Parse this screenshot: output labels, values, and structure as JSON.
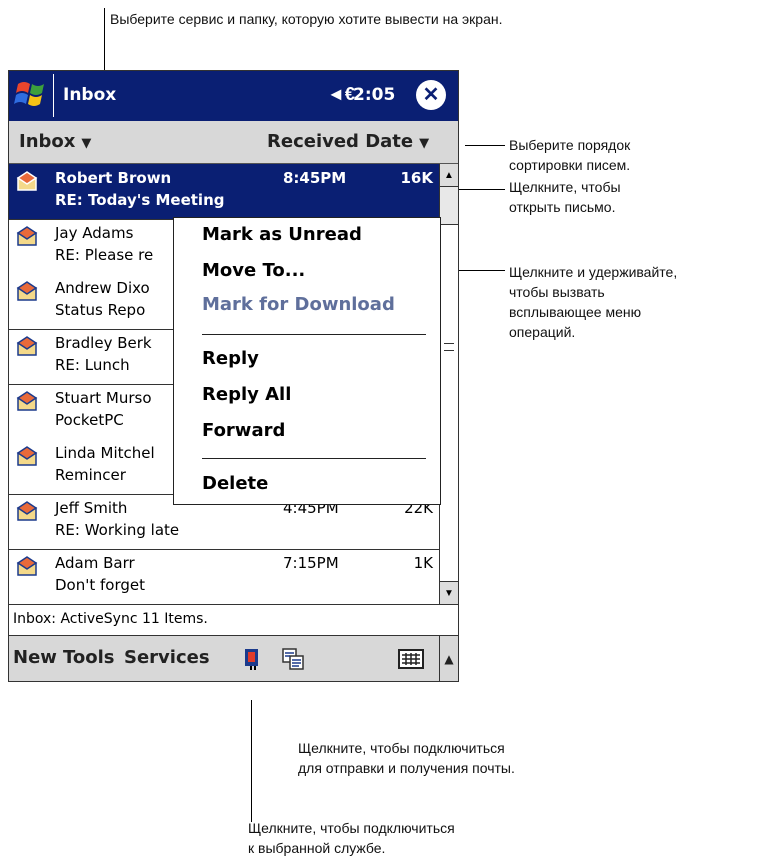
{
  "callouts": {
    "top": "Выберите сервис и папку, которую хотите вывести на экран.",
    "sort": "Выберите порядок\nсортировки писем.",
    "open": "Щелкните, чтобы\nоткрыть письмо.",
    "hold": "Щелкните и удерживайте,\nчтобы вызвать\nвсплывающее меню\nопераций.",
    "send_receive": "Щелкните, чтобы подключиться\nдля отправки и получения почты.",
    "connect_service": "Щелкните, чтобы подключиться\nк выбранной службе."
  },
  "titlebar": {
    "title": "Inbox",
    "volume_icon": "speaker-icon",
    "volume_glyph": "◄€",
    "time": "2:05",
    "close_glyph": "✕"
  },
  "sortbar": {
    "folder": "Inbox",
    "order": "Received Date",
    "arrow": "▼"
  },
  "messages": [
    {
      "sender": "Robert Brown",
      "subject": "RE: Today's Meeting",
      "time": "8:45PM",
      "size": "16K",
      "selected": true
    },
    {
      "sender": "Jay Adams",
      "subject": "RE: Please re",
      "time": "",
      "size": ""
    },
    {
      "sender": "Andrew Dixo",
      "subject": "Status Repo",
      "time": "",
      "size": ""
    },
    {
      "sender": "Bradley Berk",
      "subject": "RE: Lunch",
      "time": "",
      "size": ""
    },
    {
      "sender": "Stuart Murso",
      "subject": "PocketPC",
      "time": "",
      "size": ""
    },
    {
      "sender": "Linda Mitchel",
      "subject": "Remincer",
      "time": "",
      "size": ""
    },
    {
      "sender": "Jeff Smith",
      "subject": "RE: Working late",
      "time": "4:45PM",
      "size": "22K"
    },
    {
      "sender": "Adam Barr",
      "subject": "Don't forget",
      "time": "7:15PM",
      "size": "1K"
    }
  ],
  "context_menu": {
    "mark_unread": "Mark as Unread",
    "move_to": "Move To...",
    "mark_download": "Mark for Download",
    "reply": "Reply",
    "reply_all": "Reply All",
    "forward": "Forward",
    "delete": "Delete"
  },
  "status": "Inbox: ActiveSync  11 Items.",
  "commandbar": {
    "new": "New",
    "tools": "Tools",
    "services": "Services",
    "up_glyph": "▲"
  },
  "scrollbar": {
    "up_glyph": "▲",
    "down_glyph": "▼"
  },
  "colors": {
    "titlebar_bg": "#0a1f73",
    "selection_bg": "#0a1f73",
    "bar_bg": "#d8d8d8",
    "disabled_text": "#5f6f9b"
  }
}
